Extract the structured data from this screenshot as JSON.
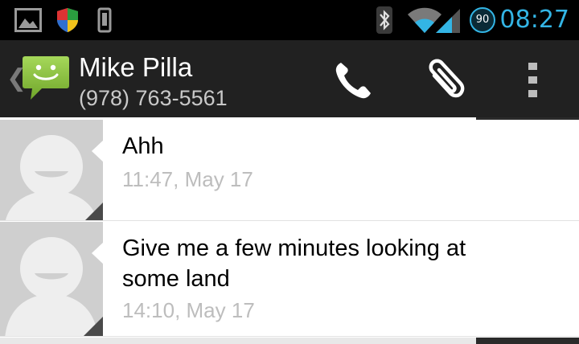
{
  "status_bar": {
    "time": "08:27",
    "battery_level": "90",
    "icons": [
      "gallery-icon",
      "shield-icon",
      "vibrate-icon",
      "bluetooth-icon",
      "wifi-icon",
      "signal-icon",
      "battery-icon"
    ],
    "time_color": "#33b5e5"
  },
  "action_bar": {
    "up_glyph": "❮",
    "contact_name": "Mike Pilla",
    "contact_number": "(978) 763-5561",
    "icons": [
      "messaging-app-icon",
      "phone-icon",
      "attach-icon",
      "overflow-menu-icon"
    ]
  },
  "messages": [
    {
      "text": "Ahh",
      "time": "11:47, May 17"
    },
    {
      "text": "Give me a few minutes looking at some land",
      "time": "14:10, May 17"
    }
  ],
  "colors": {
    "app_icon_green": "#8cc63e",
    "action_bar_bg": "#212121",
    "timestamp_gray": "#bdbdbd"
  }
}
